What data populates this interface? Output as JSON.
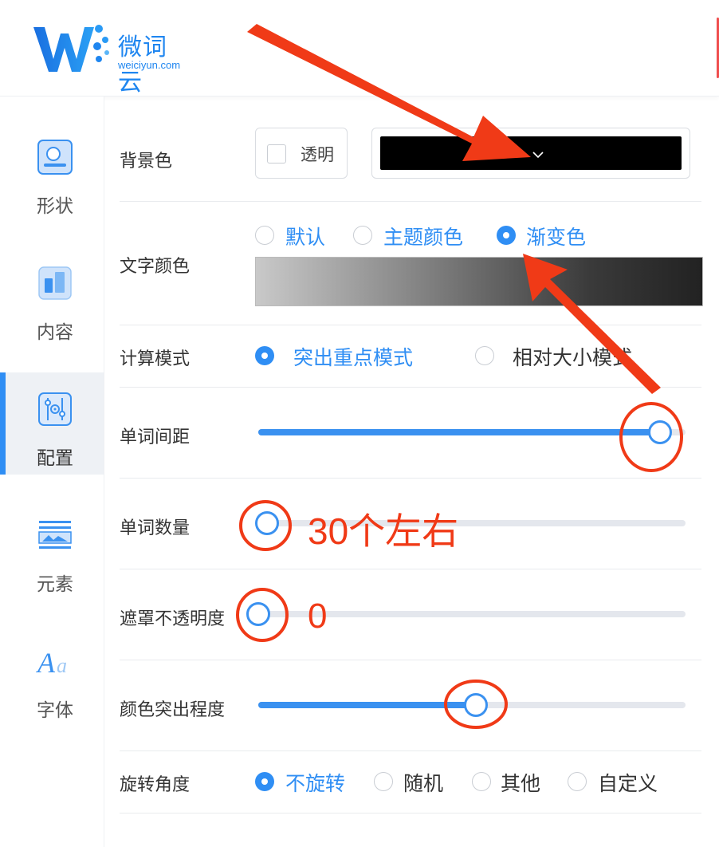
{
  "brand": {
    "name": "微词云",
    "domain": "weiciyun.com",
    "color": "#1f86f0"
  },
  "sidebar": {
    "items": [
      {
        "label": "形状",
        "icon": "shape-icon",
        "active": false
      },
      {
        "label": "内容",
        "icon": "content-icon",
        "active": false
      },
      {
        "label": "配置",
        "icon": "settings-sliders-icon",
        "active": true
      },
      {
        "label": "元素",
        "icon": "elements-icon",
        "active": false
      },
      {
        "label": "字体",
        "icon": "font-icon",
        "active": false
      }
    ]
  },
  "settings": {
    "background": {
      "label": "背景色",
      "transparent_label": "透明",
      "transparent_checked": false,
      "color": "#000000"
    },
    "text_color": {
      "label": "文字颜色",
      "options": [
        "默认",
        "主题颜色",
        "渐变色"
      ],
      "selected": "渐变色"
    },
    "calc_mode": {
      "label": "计算模式",
      "options": [
        "突出重点模式",
        "相对大小模式"
      ],
      "selected": "突出重点模式"
    },
    "word_spacing": {
      "label": "单词间距",
      "value": 0.94
    },
    "word_count": {
      "label": "单词数量",
      "value": 0.02
    },
    "mask_opacity": {
      "label": "遮罩不透明度",
      "value": 0.0
    },
    "color_emphasis": {
      "label": "颜色突出程度",
      "value": 0.51
    },
    "rotation": {
      "label": "旋转角度",
      "options": [
        "不旋转",
        "随机",
        "其他",
        "自定义"
      ],
      "selected": "不旋转"
    }
  },
  "annotations": {
    "word_count_note": "30个左右",
    "mask_note": "0",
    "color": "#f03a17"
  },
  "accent_color": "#2f8ef4"
}
